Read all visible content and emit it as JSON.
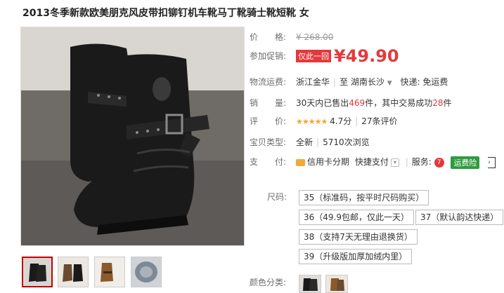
{
  "product": {
    "title": "2013冬季新款欧美朋克风皮带扣铆钉机车靴马丁靴骑士靴短靴 女"
  },
  "price": {
    "label": "价　　格:",
    "original": "¥ 268.00"
  },
  "promo": {
    "label": "参加促销:",
    "tag": "仅此一回",
    "price": "¥49.90"
  },
  "shipping": {
    "label": "物流运费:",
    "from": "浙江金华",
    "to_prefix": "至",
    "to": "湖南长沙",
    "express": "快递: 免运费"
  },
  "sales": {
    "label": "销　　量:",
    "prefix": "30天内已售出",
    "sold": "469",
    "middle": "件，其中交易成功",
    "success": "28",
    "suffix": "件"
  },
  "rating": {
    "label": "评　　价:",
    "stars": "★★★★★",
    "score": "4.7分",
    "reviews": "27条评价"
  },
  "item_type": {
    "label": "宝贝类型:",
    "condition": "全新",
    "views": "5710次浏览"
  },
  "payment": {
    "label": "支　　付:",
    "credit": "信用卡分期",
    "quick": "快捷支付",
    "service_label": "服务:",
    "service_icon": "7",
    "freight_badge": "运费险",
    "more": "›"
  },
  "size": {
    "label": "尺码:",
    "options": [
      "35（标准码，按平时尺码购买）",
      "36（49.9包邮，仅此一天）",
      "37（默认韵达快递）",
      "38（支持7天无理由退换货）",
      "39（升级版加厚加绒内里）"
    ]
  },
  "color": {
    "label": "颜色分类:"
  },
  "colors": {
    "boot_black": "#1a1a1a",
    "boot_highlight": "#3a3a3a",
    "buckle": "#8a8a8a",
    "floor": "#6f6c68",
    "wall": "#d9d6d2",
    "price_red": "#e4393c",
    "freight_green": "#2e9b3e",
    "star_orange": "#f5a623"
  }
}
